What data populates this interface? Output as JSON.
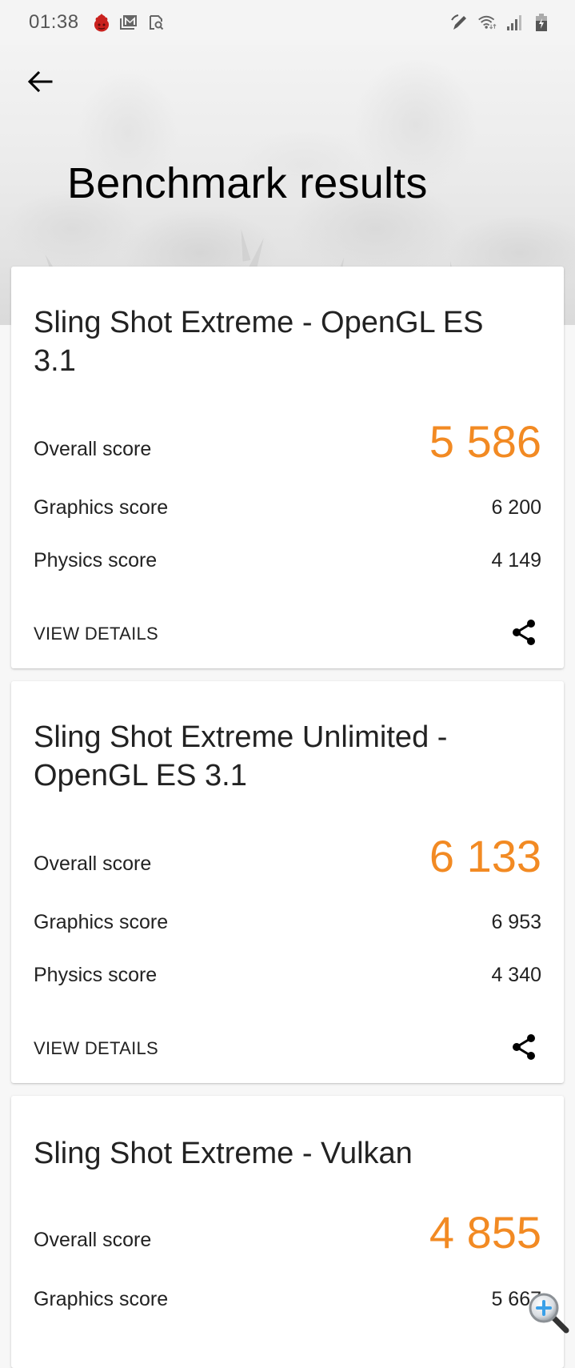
{
  "status_bar": {
    "time": "01:38",
    "left_icons": [
      "antutu-app-icon",
      "gmail-icon",
      "screen-search-icon"
    ],
    "right_icons": [
      "pen-icon",
      "wifi-icon",
      "signal-icon",
      "battery-charging-icon"
    ]
  },
  "header": {
    "back_icon": "arrow-left-icon",
    "title": "Benchmark results"
  },
  "accent_color": "#f28a23",
  "results": [
    {
      "title": "Sling Shot Extreme - OpenGL ES 3.1",
      "overall_label": "Overall score",
      "overall_value": "5 586",
      "graphics_label": "Graphics score",
      "graphics_value": "6 200",
      "physics_label": "Physics score",
      "physics_value": "4 149",
      "view_details_label": "VIEW DETAILS",
      "share_icon": "share-icon"
    },
    {
      "title": "Sling Shot Extreme Unlimited - OpenGL ES 3.1",
      "overall_label": "Overall score",
      "overall_value": "6 133",
      "graphics_label": "Graphics score",
      "graphics_value": "6 953",
      "physics_label": "Physics score",
      "physics_value": "4 340",
      "view_details_label": "VIEW DETAILS",
      "share_icon": "share-icon"
    },
    {
      "title": "Sling Shot Extreme - Vulkan",
      "overall_label": "Overall score",
      "overall_value": "4 855",
      "graphics_label": "Graphics score",
      "graphics_value": "5 667"
    }
  ],
  "overlay": {
    "zoom_icon": "magnifier-zoom-in-icon"
  }
}
